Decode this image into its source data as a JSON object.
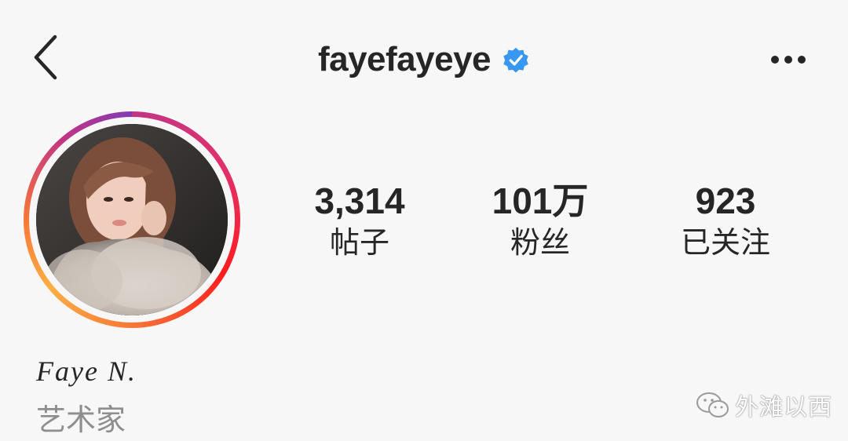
{
  "header": {
    "username": "fayefayeye",
    "back_icon": "chevron-left-icon",
    "verified_icon": "verified-badge-icon",
    "more_icon": "more-horizontal-icon"
  },
  "profile": {
    "display_name": "Faye N.",
    "category": "艺术家"
  },
  "stats": [
    {
      "value": "3,314",
      "label": "帖子"
    },
    {
      "value": "101万",
      "label": "粉丝"
    },
    {
      "value": "923",
      "label": "已关注"
    }
  ],
  "watermark": {
    "text": "外滩以西",
    "icon": "wechat-icon"
  },
  "colors": {
    "background": "#f7f7f7",
    "text": "#262626",
    "muted": "#8e8e8e",
    "verified": "#3897f0"
  }
}
